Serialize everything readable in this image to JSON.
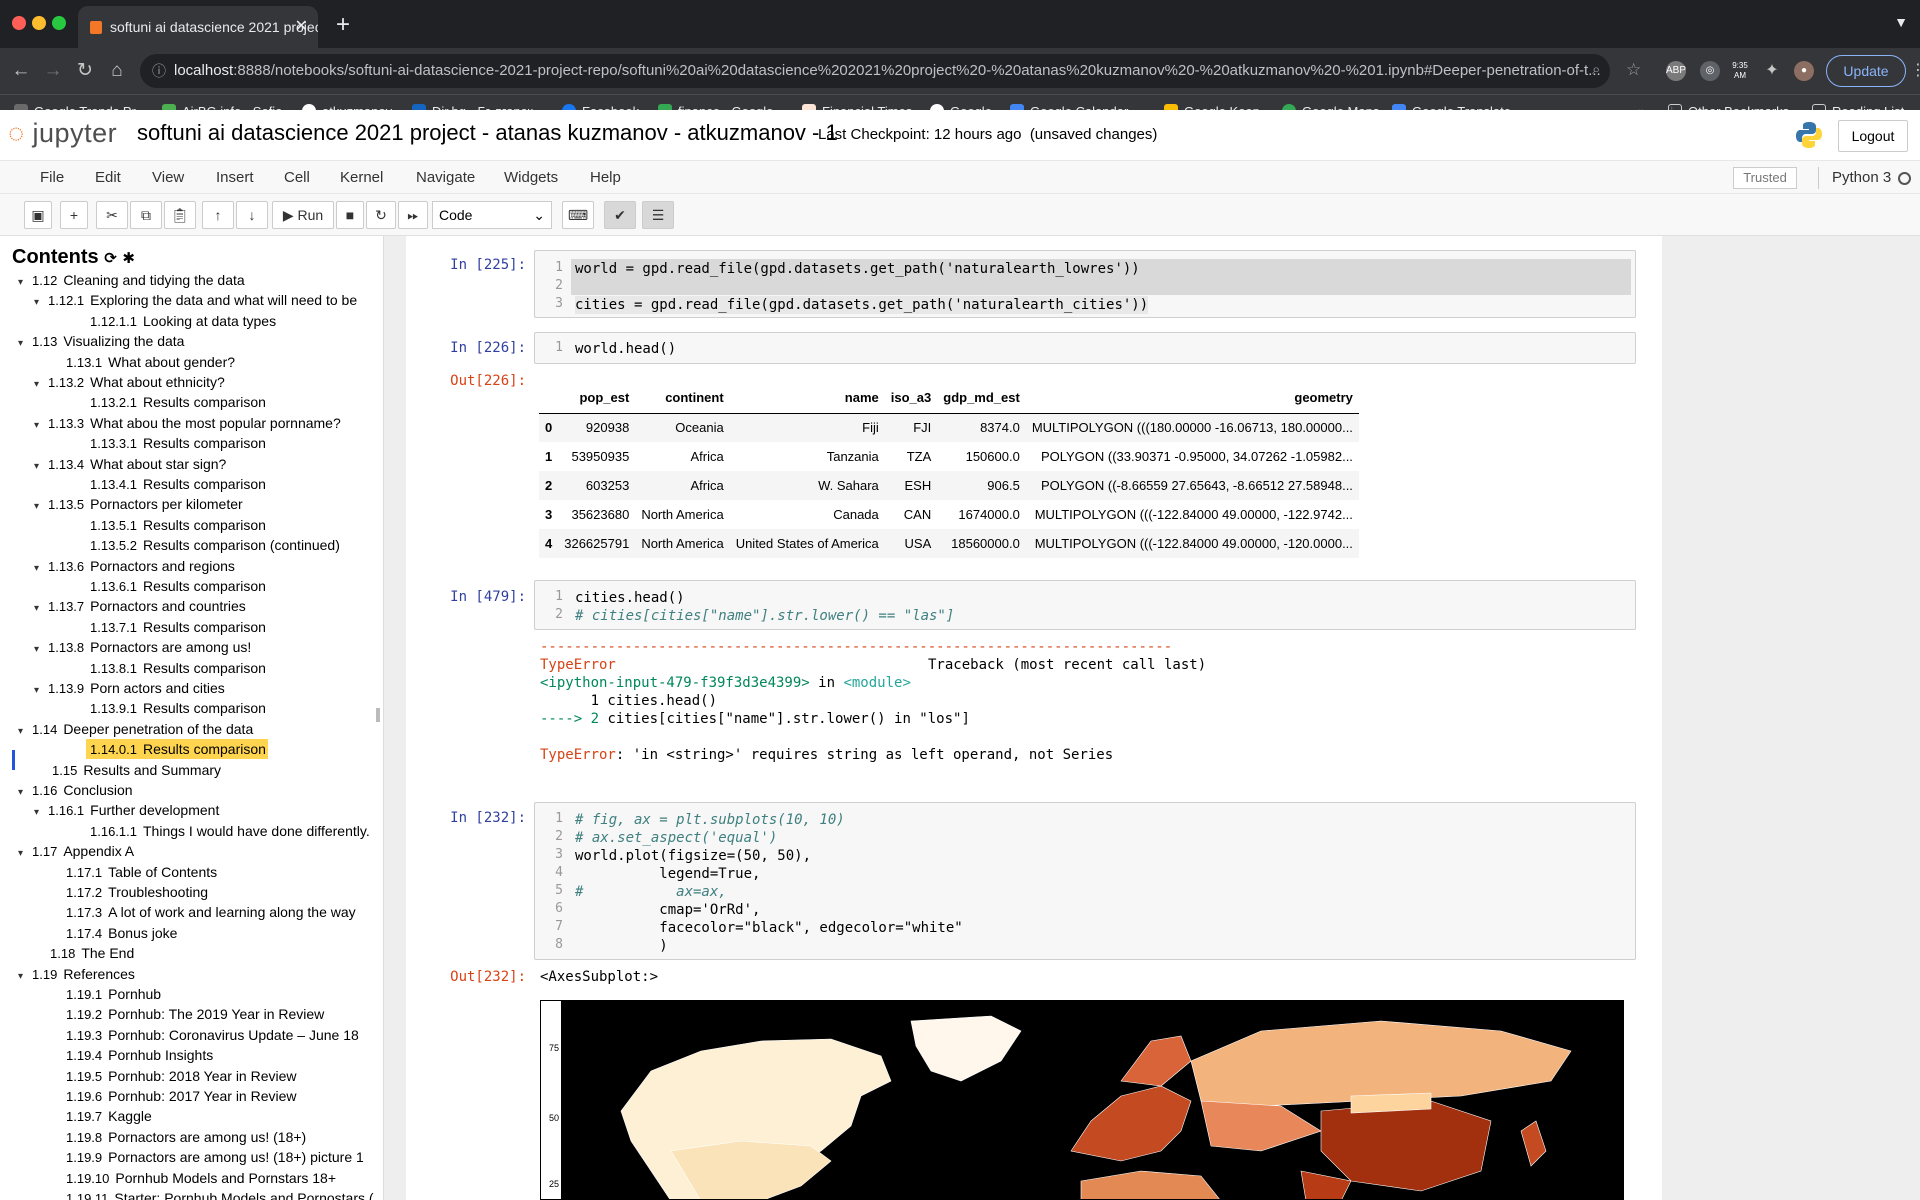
{
  "browser": {
    "tab_title": "softuni ai datascience 2021 project - atanas kuzmanov - atkuzmanov - 1",
    "url_host": "localhost",
    "url_rest": ":8888/notebooks/softuni-ai-datascience-2021-project-repo/softuni%20ai%20datascience%202021%20project%20-%20atanas%20kuzmanov%20-%20atkuzmanov%20-%201.ipynb#Deeper-penetration-of-t...",
    "update_label": "Update",
    "bookmarks": [
      "Google Trends Pr...",
      "AirBG.info - Sofia",
      "atkuzmanov",
      "Dir.bg - Българск...",
      "Facebook",
      "finance - Google...",
      "Financial Times",
      "Google",
      "Google Calendar -...",
      "Google Keep",
      "Google Maps",
      "Google Translate"
    ],
    "other_bookmarks": "Other Bookmarks",
    "reading_list": "Reading List",
    "clock_ext": "9:35 AM"
  },
  "jupyter": {
    "logo": "jupyter",
    "title": "softuni ai datascience 2021 project - atanas kuzmanov - atkuzmanov - 1",
    "checkpoint": "Last Checkpoint: 12 hours ago",
    "unsaved": "(unsaved changes)",
    "logout": "Logout",
    "menus": [
      "File",
      "Edit",
      "View",
      "Insert",
      "Cell",
      "Kernel",
      "Navigate",
      "Widgets",
      "Help"
    ],
    "trusted": "Trusted",
    "kernel": "Python 3",
    "run_label": "Run",
    "cell_type": "Code"
  },
  "toc": {
    "header": "Contents",
    "items": [
      {
        "num": "1.12",
        "label": "Cleaning and tidying the data",
        "caret": true
      },
      {
        "num": "1.12.1",
        "label": "Exploring the data and what will need to be",
        "caret": true
      },
      {
        "num": "1.12.1.1",
        "label": "Looking at data types",
        "caret": false
      },
      {
        "num": "1.13",
        "label": "Visualizing the data",
        "caret": true
      },
      {
        "num": "1.13.1",
        "label": "What about gender?",
        "caret": false
      },
      {
        "num": "1.13.2",
        "label": "What about ethnicity?",
        "caret": true
      },
      {
        "num": "1.13.2.1",
        "label": "Results comparison",
        "caret": false
      },
      {
        "num": "1.13.3",
        "label": "What abou the most popular pornname?",
        "caret": true
      },
      {
        "num": "1.13.3.1",
        "label": "Results comparison",
        "caret": false
      },
      {
        "num": "1.13.4",
        "label": "What about star sign?",
        "caret": true
      },
      {
        "num": "1.13.4.1",
        "label": "Results comparison",
        "caret": false
      },
      {
        "num": "1.13.5",
        "label": "Pornactors per kilometer",
        "caret": true
      },
      {
        "num": "1.13.5.1",
        "label": "Results comparison",
        "caret": false
      },
      {
        "num": "1.13.5.2",
        "label": "Results comparison (continued)",
        "caret": false
      },
      {
        "num": "1.13.6",
        "label": "Pornactors and regions",
        "caret": true
      },
      {
        "num": "1.13.6.1",
        "label": "Results comparison",
        "caret": false
      },
      {
        "num": "1.13.7",
        "label": "Pornactors and countries",
        "caret": true
      },
      {
        "num": "1.13.7.1",
        "label": "Results comparison",
        "caret": false
      },
      {
        "num": "1.13.8",
        "label": "Pornactors are among us!",
        "caret": true
      },
      {
        "num": "1.13.8.1",
        "label": "Results comparison",
        "caret": false
      },
      {
        "num": "1.13.9",
        "label": "Porn actors and cities",
        "caret": true
      },
      {
        "num": "1.13.9.1",
        "label": "Results comparison",
        "caret": false
      },
      {
        "num": "1.14",
        "label": "Deeper penetration of the data",
        "caret": true
      },
      {
        "num": "1.14.0.1",
        "label": "Results comparison",
        "caret": false
      },
      {
        "num": "1.15",
        "label": "Results and Summary",
        "caret": false
      },
      {
        "num": "1.16",
        "label": "Conclusion",
        "caret": true
      },
      {
        "num": "1.16.1",
        "label": "Further development",
        "caret": true
      },
      {
        "num": "1.16.1.1",
        "label": "Things I would have done differently.",
        "caret": false
      },
      {
        "num": "1.17",
        "label": "Appendix A",
        "caret": true
      },
      {
        "num": "1.17.1",
        "label": "Table of Contents",
        "caret": false
      },
      {
        "num": "1.17.2",
        "label": "Troubleshooting",
        "caret": false
      },
      {
        "num": "1.17.3",
        "label": "A lot of work and learning along the way",
        "caret": false
      },
      {
        "num": "1.17.4",
        "label": "Bonus joke",
        "caret": false
      },
      {
        "num": "1.18",
        "label": "The End",
        "caret": false
      },
      {
        "num": "1.19",
        "label": "References",
        "caret": true
      },
      {
        "num": "1.19.1",
        "label": "Pornhub",
        "caret": false
      },
      {
        "num": "1.19.2",
        "label": "Pornhub: The 2019 Year in Review",
        "caret": false
      },
      {
        "num": "1.19.3",
        "label": "Pornhub: Coronavirus Update – June 18",
        "caret": false
      },
      {
        "num": "1.19.4",
        "label": "Pornhub Insights",
        "caret": false
      },
      {
        "num": "1.19.5",
        "label": "Pornhub: 2018 Year in Review",
        "caret": false
      },
      {
        "num": "1.19.6",
        "label": "Pornhub: 2017 Year in Review",
        "caret": false
      },
      {
        "num": "1.19.7",
        "label": "Kaggle",
        "caret": false
      },
      {
        "num": "1.19.8",
        "label": "Pornactors are among us! (18+)",
        "caret": false
      },
      {
        "num": "1.19.9",
        "label": "Pornactors are among us! (18+) picture 1",
        "caret": false
      },
      {
        "num": "1.19.10",
        "label": "Pornhub Models and Pornstars 18+",
        "caret": false
      },
      {
        "num": "1.19.11",
        "label": "Starter: Pornhub Models and Pornostars (",
        "caret": false
      }
    ]
  },
  "cells": {
    "c225": {
      "prompt": "In [225]:",
      "line1": "world = gpd.read_file(gpd.datasets.get_path('naturalearth_lowres'))",
      "line3": "cities = gpd.read_file(gpd.datasets.get_path('naturalearth_cities'))"
    },
    "c226": {
      "prompt": "In [226]:",
      "code": "world.head()",
      "out_prompt": "Out[226]:",
      "columns": [
        "",
        "pop_est",
        "continent",
        "name",
        "iso_a3",
        "gdp_md_est",
        "geometry"
      ],
      "rows": [
        [
          "0",
          "920938",
          "Oceania",
          "Fiji",
          "FJI",
          "8374.0",
          "MULTIPOLYGON (((180.00000 -16.06713, 180.00000..."
        ],
        [
          "1",
          "53950935",
          "Africa",
          "Tanzania",
          "TZA",
          "150600.0",
          "POLYGON ((33.90371 -0.95000, 34.07262 -1.05982..."
        ],
        [
          "2",
          "603253",
          "Africa",
          "W. Sahara",
          "ESH",
          "906.5",
          "POLYGON ((-8.66559 27.65643, -8.66512 27.58948..."
        ],
        [
          "3",
          "35623680",
          "North America",
          "Canada",
          "CAN",
          "1674000.0",
          "MULTIPOLYGON (((-122.84000 49.00000, -122.9742..."
        ],
        [
          "4",
          "326625791",
          "North America",
          "United States of America",
          "USA",
          "18560000.0",
          "MULTIPOLYGON (((-122.84000 49.00000, -120.0000..."
        ]
      ]
    },
    "c479": {
      "prompt": "In [479]:",
      "line1": "cities.head()",
      "line2": "# cities[cities[\"name\"].str.lower() == \"las\"]",
      "tb_rule": "---------------------------------------------------------------------------",
      "tb_type": "TypeError",
      "tb_header": "Traceback (most recent call last)",
      "tb_input": "<ipython-input-479-f39f3d3e4399>",
      "tb_in": " in ",
      "tb_module": "<module>",
      "tb_l1": "      1 cities.head()",
      "tb_arrow": "----> 2 ",
      "tb_l2": "cities[cities[\"name\"].str.lower() in \"los\"]",
      "err_type": "TypeError",
      "err_msg": ": 'in <string>' requires string as left operand, not Series"
    },
    "c232": {
      "prompt": "In [232]:",
      "lines": [
        "# fig, ax = plt.subplots(10, 10)",
        "# ax.set_aspect('equal')",
        "world.plot(figsize=(50, 50),",
        "          legend=True,",
        "#           ax=ax,",
        "          cmap='OrRd',",
        "          facecolor=\"black\", edgecolor=\"white\"",
        "          )"
      ],
      "out_prompt": "Out[232]:",
      "out_text": "<AxesSubplot:>",
      "yticks": [
        "75",
        "50",
        "25"
      ]
    }
  },
  "colors": {
    "jupyter_orange": "#f37726",
    "prompt_in": "#303f9f",
    "prompt_out": "#d84315",
    "toc_highlight": "#ffd700"
  }
}
